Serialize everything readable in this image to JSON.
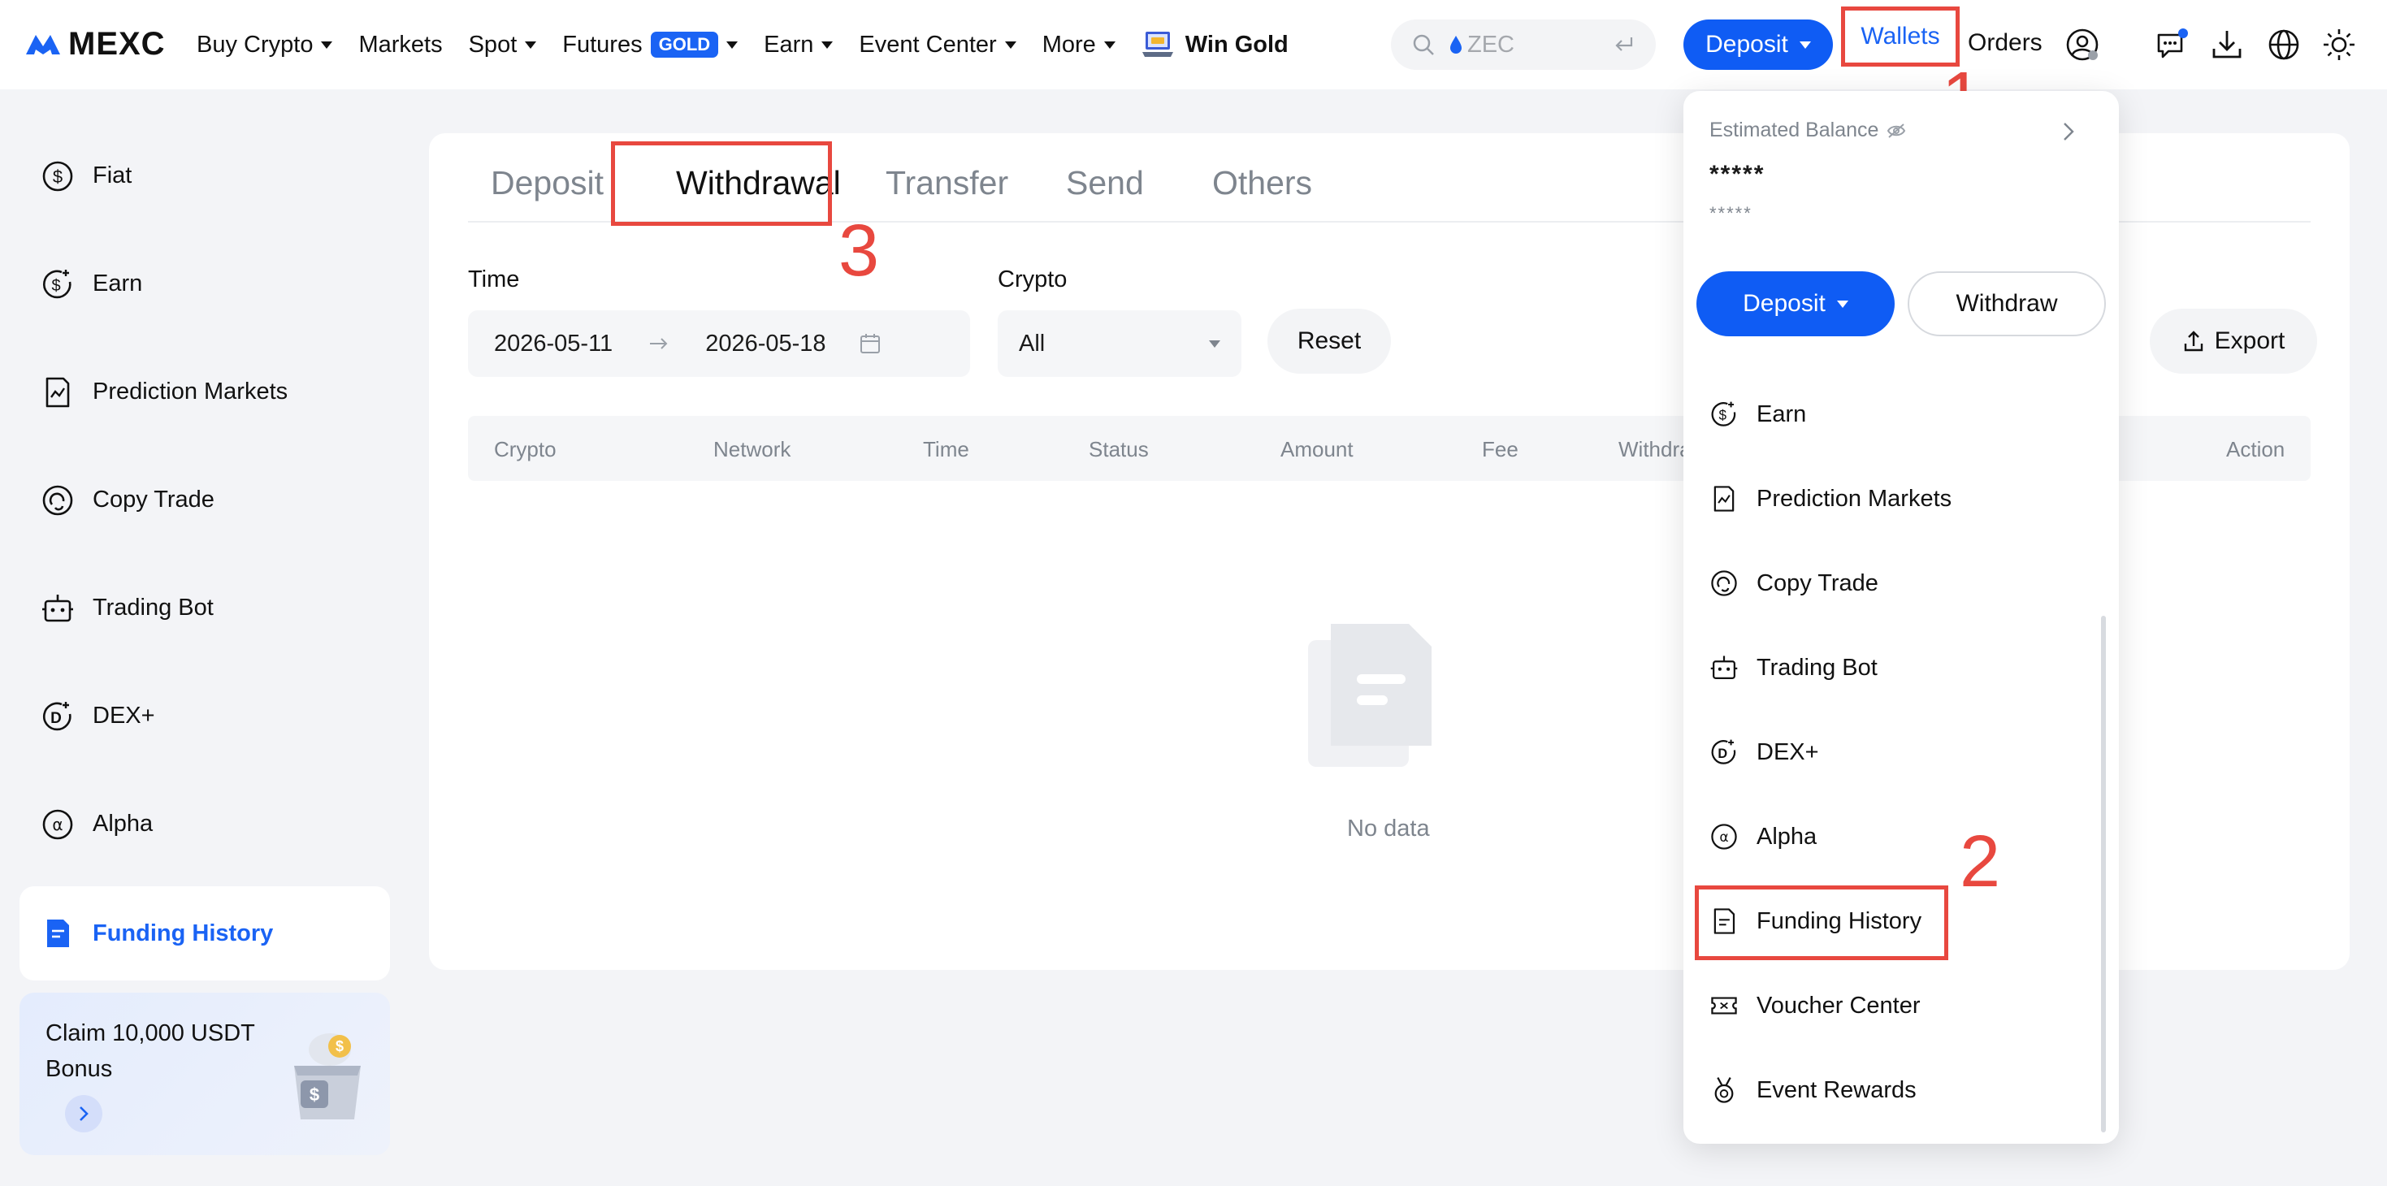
{
  "brand": {
    "name": "MEXC",
    "accent": "#1a63f4",
    "annotation_color": "#e8483f"
  },
  "nav": {
    "items": [
      {
        "label": "Buy Crypto",
        "dropdown": true
      },
      {
        "label": "Markets",
        "dropdown": false
      },
      {
        "label": "Spot",
        "dropdown": true
      },
      {
        "label": "Futures",
        "badge": "GOLD",
        "dropdown": true
      },
      {
        "label": "Earn",
        "dropdown": true
      },
      {
        "label": "Event Center",
        "dropdown": true
      },
      {
        "label": "More",
        "dropdown": true
      }
    ],
    "win_gold": "Win Gold",
    "search_placeholder": "ZEC",
    "deposit": "Deposit",
    "wallets": "Wallets",
    "orders": "Orders",
    "icons": [
      "user-icon",
      "message-icon",
      "download-icon",
      "globe-icon",
      "sun-icon"
    ]
  },
  "sidebar": {
    "items": [
      {
        "label": "Fiat",
        "icon": "fiat-icon"
      },
      {
        "label": "Earn",
        "icon": "earn-icon"
      },
      {
        "label": "Prediction Markets",
        "icon": "prediction-icon"
      },
      {
        "label": "Copy Trade",
        "icon": "copy-trade-icon"
      },
      {
        "label": "Trading Bot",
        "icon": "bot-icon"
      },
      {
        "label": "DEX+",
        "icon": "dex-icon"
      },
      {
        "label": "Alpha",
        "icon": "alpha-icon"
      },
      {
        "label": "Funding History",
        "icon": "funding-history-icon",
        "active": true
      }
    ],
    "promo": {
      "text": "Claim 10,000 USDT Bonus"
    }
  },
  "main": {
    "tabs": [
      "Deposit",
      "Withdrawal",
      "Transfer",
      "Send",
      "Others"
    ],
    "active_tab": "Withdrawal",
    "filters": {
      "time_label": "Time",
      "start_date": "2026-05-11",
      "end_date": "2026-05-18",
      "crypto_label": "Crypto",
      "crypto_value": "All",
      "reset": "Reset",
      "export": "Export"
    },
    "columns": [
      "Crypto",
      "Network",
      "Time",
      "Status",
      "Amount",
      "Fee",
      "Withdra",
      "Action"
    ],
    "empty_text": "No data"
  },
  "dropdown": {
    "estimated_balance": "Estimated Balance",
    "balance_masked": "*****",
    "balance_sub_masked": "*****",
    "deposit": "Deposit",
    "withdraw": "Withdraw",
    "items": [
      {
        "label": "Earn",
        "icon": "earn-icon"
      },
      {
        "label": "Prediction Markets",
        "icon": "prediction-icon"
      },
      {
        "label": "Copy Trade",
        "icon": "copy-trade-icon"
      },
      {
        "label": "Trading Bot",
        "icon": "bot-icon"
      },
      {
        "label": "DEX+",
        "icon": "dex-icon"
      },
      {
        "label": "Alpha",
        "icon": "alpha-icon"
      },
      {
        "label": "Funding History",
        "icon": "funding-history-icon"
      },
      {
        "label": "Voucher Center",
        "icon": "voucher-icon"
      },
      {
        "label": "Event Rewards",
        "icon": "medal-icon"
      }
    ]
  },
  "annotations": [
    "1",
    "2",
    "3"
  ]
}
